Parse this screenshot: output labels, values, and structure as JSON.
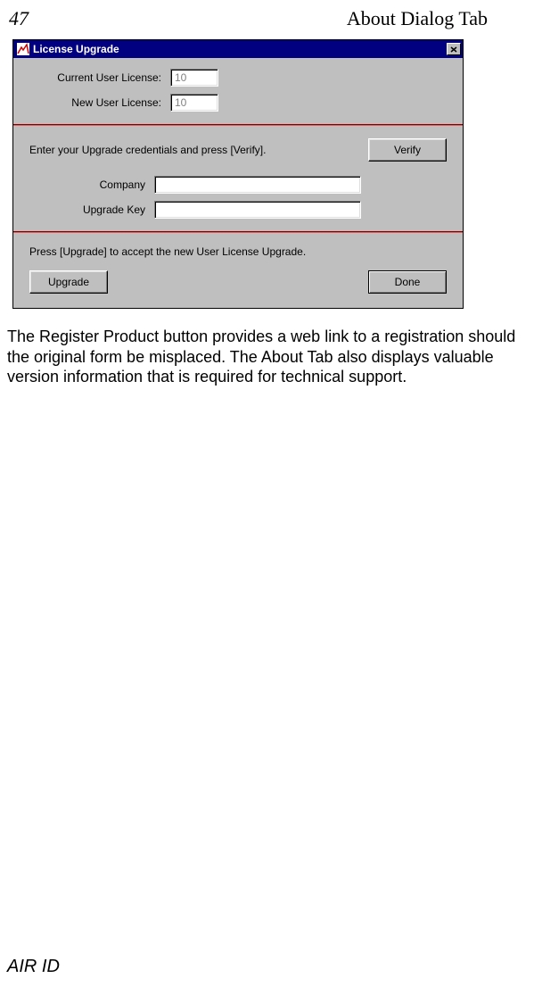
{
  "header": {
    "page_number": "47",
    "title": "About Dialog Tab"
  },
  "dialog": {
    "title": "License Upgrade",
    "section1": {
      "current_label": "Current User License:",
      "current_value": "10",
      "new_label": "New User License:",
      "new_value": "10"
    },
    "section2": {
      "instruction": "Enter your Upgrade credentials and press [Verify].",
      "verify_button": "Verify",
      "company_label": "Company",
      "company_value": "",
      "key_label": "Upgrade Key",
      "key_value": ""
    },
    "section3": {
      "instruction": "Press [Upgrade] to accept the new User License Upgrade.",
      "upgrade_button": "Upgrade",
      "done_button": "Done"
    }
  },
  "body_text": "The Register Product button provides a web link to a registration should the original form be misplaced.  The About Tab also displays valuable version information that is required for technical support.",
  "footer": "AIR ID"
}
